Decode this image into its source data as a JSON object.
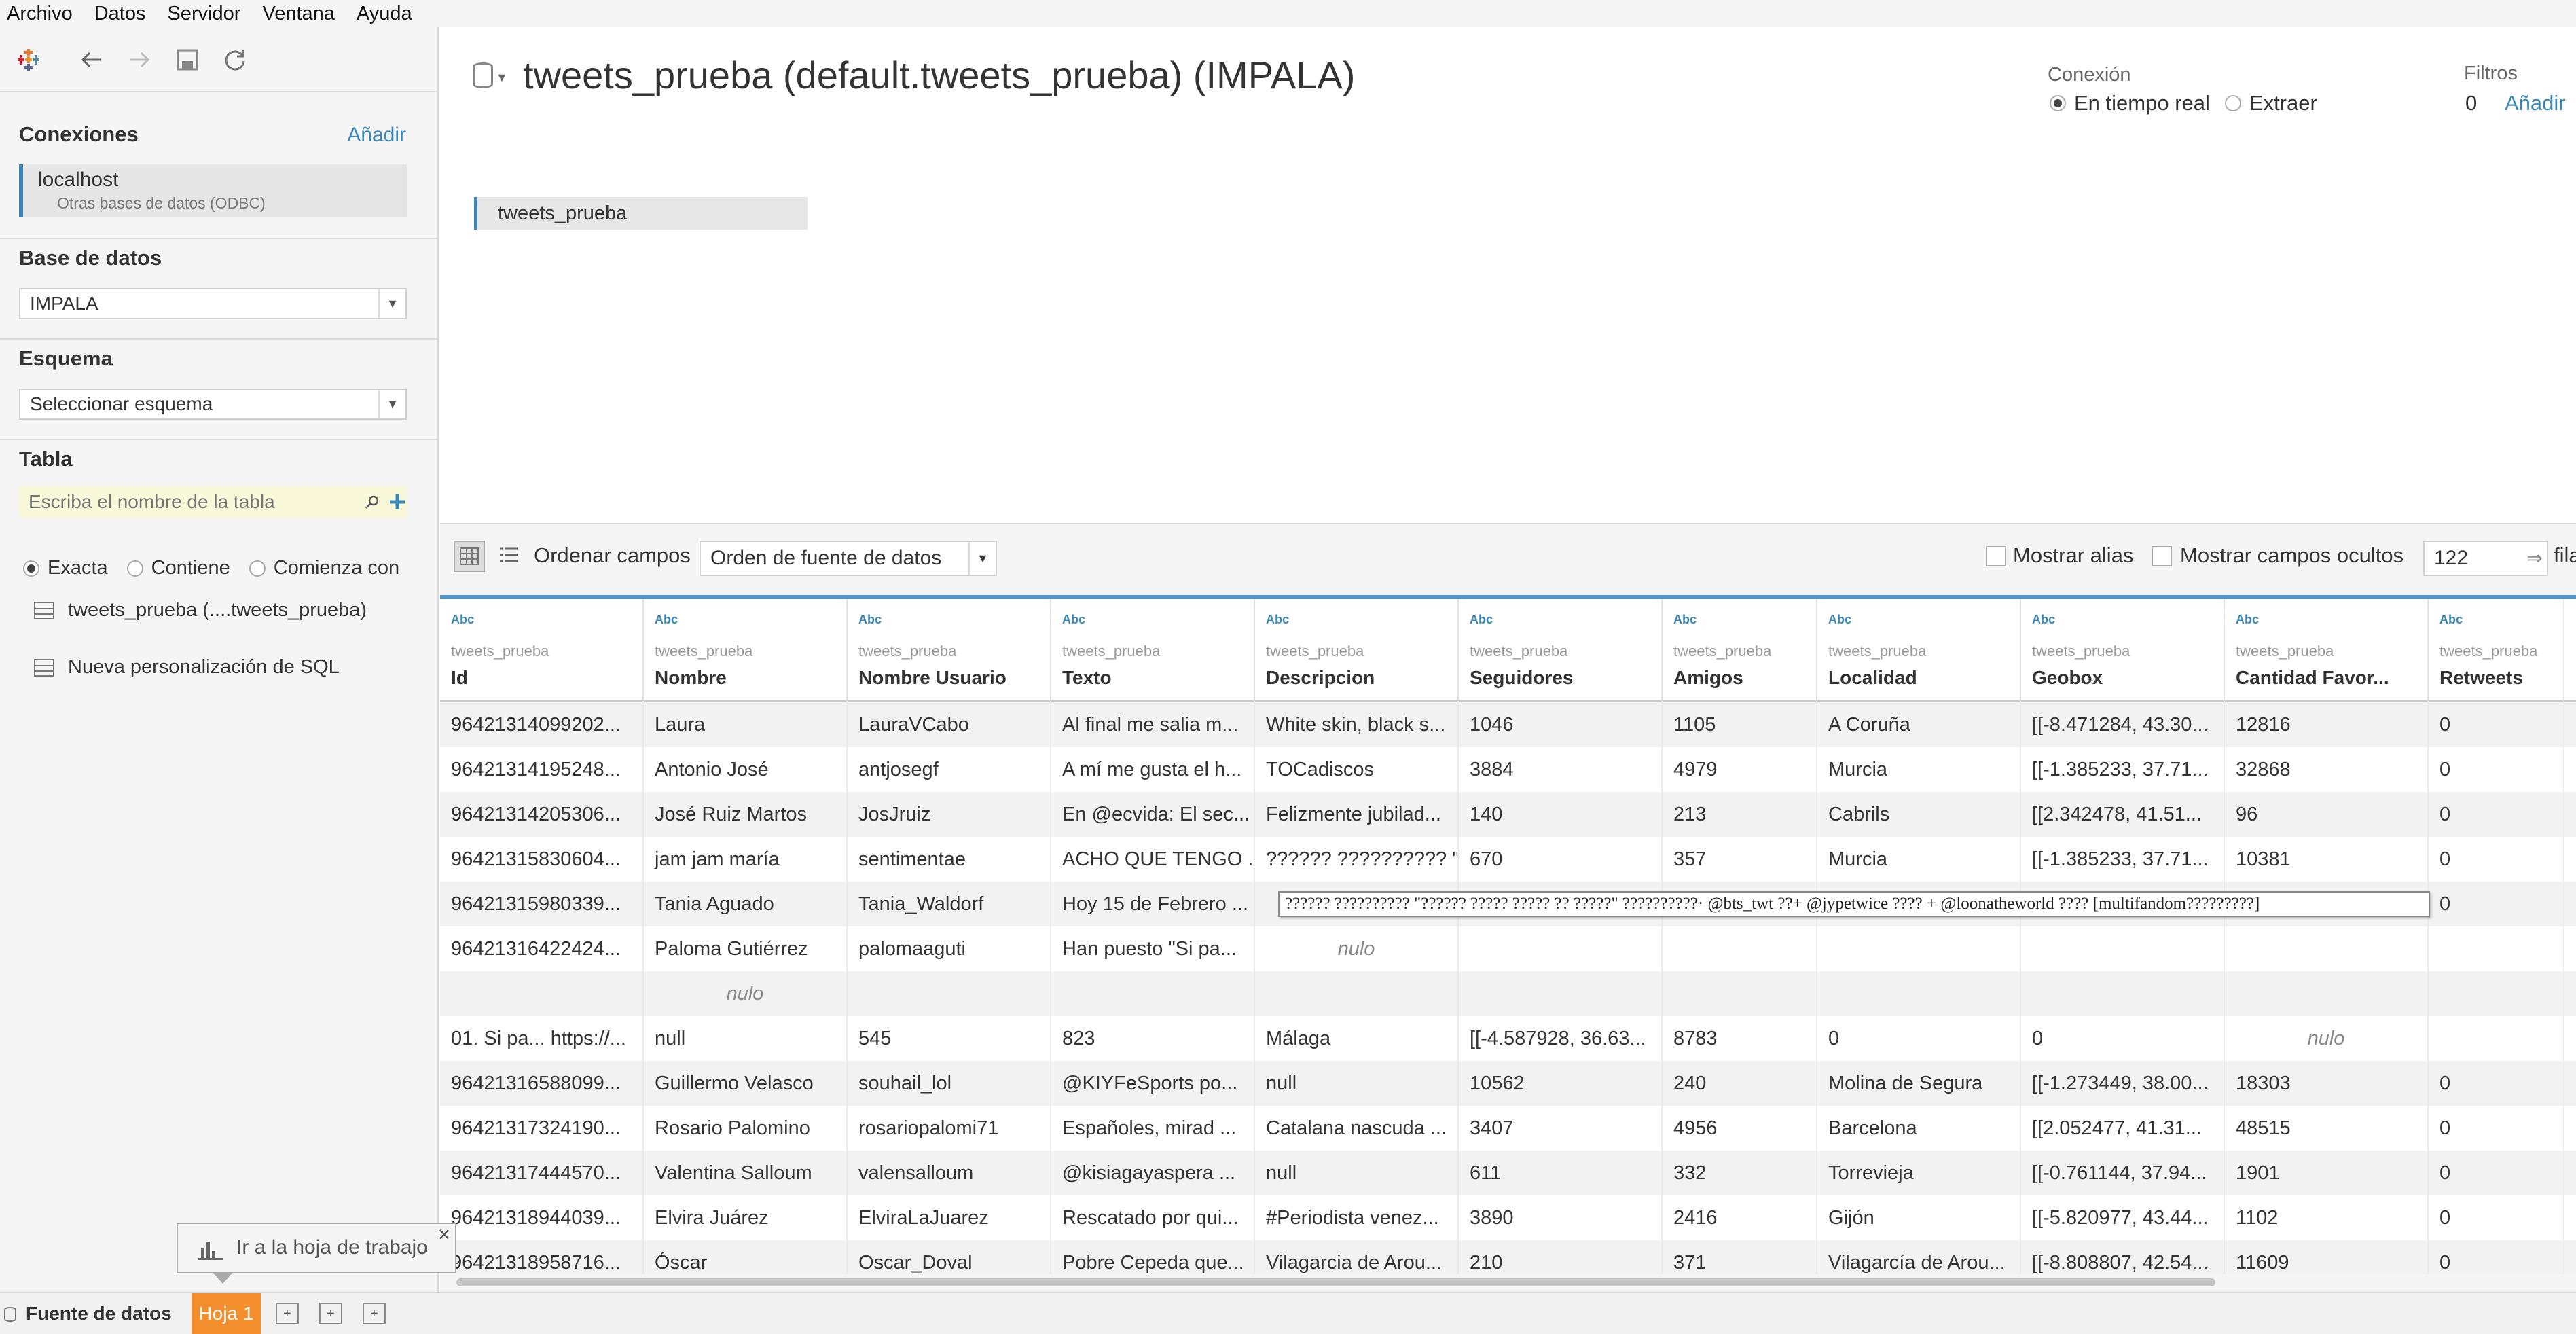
{
  "menu": [
    "Archivo",
    "Datos",
    "Servidor",
    "Ventana",
    "Ayuda"
  ],
  "sidebar": {
    "connections_title": "Conexiones",
    "add_label": "Añadir",
    "connection": {
      "name": "localhost",
      "type": "Otras bases de datos (ODBC)"
    },
    "database_title": "Base de datos",
    "database_value": "IMPALA",
    "schema_title": "Esquema",
    "schema_value": "Seleccionar esquema",
    "table_title": "Tabla",
    "table_search_placeholder": "Escriba el nombre de la tabla",
    "match_options": [
      "Exacta",
      "Contiene",
      "Comienza con"
    ],
    "tables": [
      "tweets_prueba (....tweets_prueba)"
    ],
    "custom_sql": "Nueva personalización de SQL"
  },
  "header": {
    "title": "tweets_prueba (default.tweets_prueba) (IMPALA)",
    "connection_label": "Conexión",
    "connection_options": [
      "En tiempo real",
      "Extraer"
    ],
    "filters_label": "Filtros",
    "filters_count": "0",
    "filters_add": "Añadir"
  },
  "canvas": {
    "table_name": "tweets_prueba"
  },
  "grid_toolbar": {
    "sort_label": "Ordenar campos",
    "sort_value": "Orden de fuente de datos",
    "show_alias": "Mostrar alias",
    "show_hidden": "Mostrar campos ocultos",
    "row_count": "122",
    "rows_suffix": "fila"
  },
  "columns": [
    {
      "type": "Abc",
      "source": "tweets_prueba",
      "name": "Id"
    },
    {
      "type": "Abc",
      "source": "tweets_prueba",
      "name": "Nombre"
    },
    {
      "type": "Abc",
      "source": "tweets_prueba",
      "name": "Nombre Usuario"
    },
    {
      "type": "Abc",
      "source": "tweets_prueba",
      "name": "Texto"
    },
    {
      "type": "Abc",
      "source": "tweets_prueba",
      "name": "Descripcion"
    },
    {
      "type": "Abc",
      "source": "tweets_prueba",
      "name": "Seguidores"
    },
    {
      "type": "Abc",
      "source": "tweets_prueba",
      "name": "Amigos"
    },
    {
      "type": "Abc",
      "source": "tweets_prueba",
      "name": "Localidad"
    },
    {
      "type": "Abc",
      "source": "tweets_prueba",
      "name": "Geobox"
    },
    {
      "type": "Abc",
      "source": "tweets_prueba",
      "name": "Cantidad Favor..."
    },
    {
      "type": "Abc",
      "source": "tweets_prueba",
      "name": "Retweets"
    }
  ],
  "rows": [
    [
      "96421314099202...",
      "Laura",
      "LauraVCabo",
      "Al final me salia m...",
      "White skin, black s...",
      "1046",
      "1105",
      "A Coruña",
      "[[-8.471284, 43.30...",
      "12816",
      "0"
    ],
    [
      "96421314195248...",
      "Antonio José",
      "antjosegf",
      "A mí me gusta el h...",
      "TOCadiscos",
      "3884",
      "4979",
      "Murcia",
      "[[-1.385233, 37.71...",
      "32868",
      "0"
    ],
    [
      "96421314205306...",
      "José Ruiz Martos",
      "JosJruiz",
      "En @ecvida: El sec...",
      "Felizmente jubilad...",
      "140",
      "213",
      "Cabrils",
      "[[2.342478, 41.51...",
      "96",
      "0"
    ],
    [
      "96421315830604...",
      "jam jam maría",
      "sentimentae",
      "ACHO QUE TENGO ...",
      "?????? ?????????? \"?...",
      "670",
      "357",
      "Murcia",
      "[[-1.385233, 37.71...",
      "10381",
      "0"
    ],
    [
      "96421315980339...",
      "Tania Aguado",
      "Tania_Waldorf",
      "Hoy 15 de Febrero ...",
      "",
      "",
      "",
      "",
      "",
      "",
      "0"
    ],
    [
      "96421316422424...",
      "Paloma Gutiérrez",
      "palomaaguti",
      "Han puesto \"Si pa...",
      "nulo",
      "",
      "",
      "",
      "",
      "",
      ""
    ],
    [
      "",
      "nulo",
      "",
      "",
      "",
      "",
      "",
      "",
      "",
      "",
      ""
    ],
    [
      "01. Si pa... https://...",
      "null",
      "545",
      "823",
      "Málaga",
      "[[-4.587928, 36.63...",
      "8783",
      "0",
      "0",
      "nulo",
      ""
    ],
    [
      "96421316588099...",
      "Guillermo Velasco",
      "souhail_lol",
      "@KIYFeSports po...",
      "null",
      "10562",
      "240",
      "Molina de Segura",
      "[[-1.273449, 38.00...",
      "18303",
      "0"
    ],
    [
      "96421317324190...",
      "Rosario Palomino",
      "rosariopalomi71",
      "Españoles, mirad ...",
      "Catalana nascuda ...",
      "3407",
      "4956",
      "Barcelona",
      "[[2.052477, 41.31...",
      "48515",
      "0"
    ],
    [
      "96421317444570...",
      "Valentina Salloum",
      "valensalloum",
      "@kisiagayaspera ...",
      "null",
      "611",
      "332",
      "Torrevieja",
      "[[-0.761144, 37.94...",
      "1901",
      "0"
    ],
    [
      "96421318944039...",
      "Elvira Juárez",
      "ElviraLaJuarez",
      "Rescatado por qui...",
      "#Periodista venez...",
      "3890",
      "2416",
      "Gijón",
      "[[-5.820977, 43.44...",
      "1102",
      "0"
    ],
    [
      "96421318958716...",
      "Óscar",
      "Oscar_Doval",
      "Pobre Cepeda que...",
      "Vilagarcia de Arou...",
      "210",
      "371",
      "Vilagarcía de Arou...",
      "[[-8.808807, 42.54...",
      "11609",
      "0"
    ]
  ],
  "tooltip": "?????? ?????????? \"?????? ????? ????? ?? ?????\" ??????????· @bts_twt ??+ @jypetwice ???? + @loonatheworld ???? [multifandom?????????]",
  "bottom": {
    "datasource_tab": "Fuente de datos",
    "sheet_tab": "Hoja 1",
    "goto_popup": "Ir a la hoja de trabajo"
  },
  "colors": {
    "accent": "#3f84b8",
    "link": "#3a87b5",
    "sheet_tab": "#f28e2b"
  }
}
